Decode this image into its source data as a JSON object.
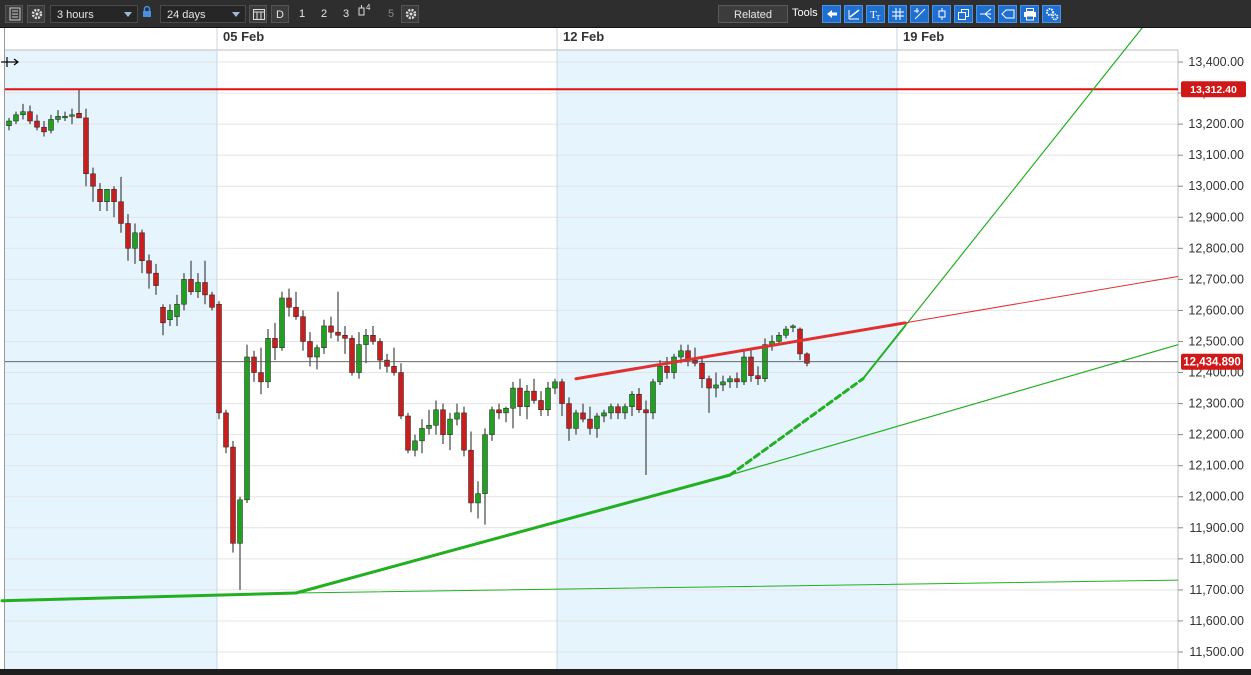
{
  "toolbar": {
    "interval": "3 hours",
    "range": "24 days",
    "d_label": "D",
    "n1": "1",
    "n2": "2",
    "n3": "3",
    "n4_sup": "4",
    "n5": "5",
    "related_label": "Related",
    "tools_label": "Tools",
    "icons": [
      "menu-icon",
      "gear-icon",
      "lock-icon",
      "calendar-icon",
      "candle-type-icon",
      "settings-icon",
      "arrow-left-icon",
      "trend-line-icon",
      "text-icon",
      "grid-icon",
      "crosshair-icon",
      "candle-icon",
      "windows-icon",
      "fork-icon",
      "shape-icon",
      "print-icon",
      "settings-alt-icon"
    ]
  },
  "colors": {
    "up": "#22a022",
    "down": "#c81e1e",
    "shade": "#e6f4fd",
    "resistance": "#e01010",
    "trend_green": "#22b022",
    "trend_red": "#e03030",
    "last_price_bg": "#d01818",
    "grid": "#e4e4e4"
  },
  "chart_data": {
    "type": "candlestick",
    "date_labels": [
      "05 Feb",
      "12 Feb",
      "19 Feb"
    ],
    "ylim": [
      11450,
      13475
    ],
    "y_ticks": [
      "11,500.00",
      "11,600.00",
      "11,700.00",
      "11,800.00",
      "11,900.00",
      "12,000.00",
      "12,100.00",
      "12,200.00",
      "12,300.00",
      "12,400.00",
      "12,500.00",
      "12,600.00",
      "12,700.00",
      "12,800.00",
      "12,900.00",
      "13,000.00",
      "13,100.00",
      "13,200.00",
      "13,300.00",
      "13,400.00"
    ],
    "y_tick_values": [
      11500,
      11600,
      11700,
      11800,
      11900,
      12000,
      12100,
      12200,
      12300,
      12400,
      12500,
      12600,
      12700,
      12800,
      12900,
      13000,
      13100,
      13200,
      13300,
      13400
    ],
    "grid": true,
    "resistance_label": "13,312.40",
    "resistance_value": 13312.4,
    "last_price_label": "12,434.890",
    "last_price_value": 12434.89,
    "candles": [
      [
        13195,
        13220,
        13180,
        13210
      ],
      [
        13210,
        13240,
        13200,
        13230
      ],
      [
        13230,
        13265,
        13215,
        13240
      ],
      [
        13240,
        13260,
        13200,
        13210
      ],
      [
        13210,
        13230,
        13180,
        13190
      ],
      [
        13190,
        13210,
        13160,
        13175
      ],
      [
        13180,
        13230,
        13170,
        13215
      ],
      [
        13215,
        13245,
        13205,
        13225
      ],
      [
        13225,
        13240,
        13210,
        13225
      ],
      [
        13225,
        13250,
        13200,
        13230
      ],
      [
        13235,
        13310,
        13220,
        13220
      ],
      [
        13220,
        13250,
        13000,
        13040
      ],
      [
        13040,
        13060,
        12950,
        13000
      ],
      [
        12990,
        13010,
        12920,
        12950
      ],
      [
        12950,
        12990,
        12920,
        12990
      ],
      [
        12990,
        13000,
        12900,
        12950
      ],
      [
        12950,
        13030,
        12850,
        12880
      ],
      [
        12880,
        12910,
        12760,
        12800
      ],
      [
        12800,
        12880,
        12750,
        12850
      ],
      [
        12850,
        12860,
        12720,
        12760
      ],
      [
        12760,
        12780,
        12670,
        12720
      ],
      [
        12720,
        12750,
        12650,
        12680
      ],
      [
        12610,
        12620,
        12520,
        12560
      ],
      [
        12570,
        12620,
        12550,
        12600
      ],
      [
        12580,
        12650,
        12550,
        12620
      ],
      [
        12620,
        12720,
        12600,
        12700
      ],
      [
        12700,
        12760,
        12650,
        12660
      ],
      [
        12660,
        12720,
        12640,
        12690
      ],
      [
        12690,
        12760,
        12620,
        12650
      ],
      [
        12650,
        12660,
        12600,
        12610
      ],
      [
        12620,
        12630,
        12250,
        12270
      ],
      [
        12270,
        12280,
        12140,
        12160
      ],
      [
        12160,
        12180,
        11820,
        11850
      ],
      [
        11850,
        12000,
        11700,
        11990
      ],
      [
        11990,
        12490,
        11980,
        12450
      ],
      [
        12450,
        12470,
        12370,
        12400
      ],
      [
        12400,
        12480,
        12330,
        12370
      ],
      [
        12370,
        12540,
        12350,
        12510
      ],
      [
        12510,
        12560,
        12440,
        12480
      ],
      [
        12480,
        12660,
        12470,
        12640
      ],
      [
        12640,
        12670,
        12580,
        12610
      ],
      [
        12610,
        12660,
        12570,
        12580
      ],
      [
        12580,
        12600,
        12470,
        12500
      ],
      [
        12500,
        12530,
        12420,
        12450
      ],
      [
        12450,
        12490,
        12410,
        12480
      ],
      [
        12480,
        12570,
        12460,
        12550
      ],
      [
        12550,
        12580,
        12510,
        12530
      ],
      [
        12530,
        12660,
        12500,
        12520
      ],
      [
        12520,
        12550,
        12460,
        12510
      ],
      [
        12510,
        12520,
        12390,
        12400
      ],
      [
        12400,
        12530,
        12380,
        12490
      ],
      [
        12490,
        12540,
        12430,
        12520
      ],
      [
        12520,
        12550,
        12490,
        12500
      ],
      [
        12500,
        12510,
        12410,
        12440
      ],
      [
        12440,
        12460,
        12400,
        12420
      ],
      [
        12420,
        12480,
        12390,
        12400
      ],
      [
        12400,
        12430,
        12250,
        12260
      ],
      [
        12260,
        12270,
        12140,
        12150
      ],
      [
        12150,
        12200,
        12130,
        12180
      ],
      [
        12180,
        12250,
        12140,
        12220
      ],
      [
        12220,
        12280,
        12200,
        12230
      ],
      [
        12230,
        12310,
        12200,
        12280
      ],
      [
        12280,
        12300,
        12170,
        12200
      ],
      [
        12200,
        12270,
        12150,
        12250
      ],
      [
        12250,
        12300,
        12230,
        12270
      ],
      [
        12270,
        12290,
        12130,
        12150
      ],
      [
        12150,
        12210,
        11950,
        11980
      ],
      [
        11980,
        12050,
        11930,
        12010
      ],
      [
        12010,
        12220,
        11910,
        12200
      ],
      [
        12200,
        12290,
        12180,
        12280
      ],
      [
        12280,
        12300,
        12250,
        12270
      ],
      [
        12270,
        12290,
        12240,
        12285
      ],
      [
        12285,
        12370,
        12220,
        12350
      ],
      [
        12350,
        12380,
        12260,
        12290
      ],
      [
        12290,
        12360,
        12250,
        12340
      ],
      [
        12340,
        12380,
        12300,
        12310
      ],
      [
        12310,
        12340,
        12260,
        12280
      ],
      [
        12280,
        12370,
        12260,
        12350
      ],
      [
        12350,
        12380,
        12330,
        12370
      ],
      [
        12370,
        12380,
        12260,
        12300
      ],
      [
        12300,
        12320,
        12180,
        12220
      ],
      [
        12220,
        12280,
        12200,
        12270
      ],
      [
        12270,
        12300,
        12240,
        12250
      ],
      [
        12250,
        12290,
        12200,
        12220
      ],
      [
        12220,
        12270,
        12190,
        12260
      ],
      [
        12260,
        12280,
        12240,
        12270
      ],
      [
        12270,
        12300,
        12250,
        12290
      ],
      [
        12290,
        12300,
        12250,
        12270
      ],
      [
        12270,
        12300,
        12250,
        12290
      ],
      [
        12290,
        12340,
        12260,
        12330
      ],
      [
        12330,
        12350,
        12270,
        12280
      ],
      [
        12280,
        12310,
        12070,
        12270
      ],
      [
        12270,
        12380,
        12250,
        12370
      ],
      [
        12370,
        12440,
        12360,
        12420
      ],
      [
        12420,
        12450,
        12380,
        12400
      ],
      [
        12400,
        12460,
        12380,
        12450
      ],
      [
        12450,
        12490,
        12430,
        12470
      ],
      [
        12470,
        12490,
        12420,
        12440
      ],
      [
        12440,
        12480,
        12420,
        12430
      ],
      [
        12430,
        12450,
        12350,
        12380
      ],
      [
        12380,
        12390,
        12270,
        12350
      ],
      [
        12350,
        12400,
        12320,
        12360
      ],
      [
        12360,
        12390,
        12340,
        12370
      ],
      [
        12370,
        12390,
        12350,
        12380
      ],
      [
        12380,
        12400,
        12350,
        12370
      ],
      [
        12370,
        12470,
        12360,
        12450
      ],
      [
        12450,
        12480,
        12370,
        12390
      ],
      [
        12390,
        12420,
        12360,
        12380
      ],
      [
        12380,
        12510,
        12370,
        12490
      ],
      [
        12490,
        12520,
        12470,
        12500
      ],
      [
        12500,
        12530,
        12490,
        12520
      ],
      [
        12520,
        12550,
        12510,
        12540
      ],
      [
        12545,
        12555,
        12530,
        12550
      ],
      [
        12540,
        12545,
        12440,
        12460
      ],
      [
        12460,
        12465,
        12420,
        12430
      ]
    ]
  }
}
